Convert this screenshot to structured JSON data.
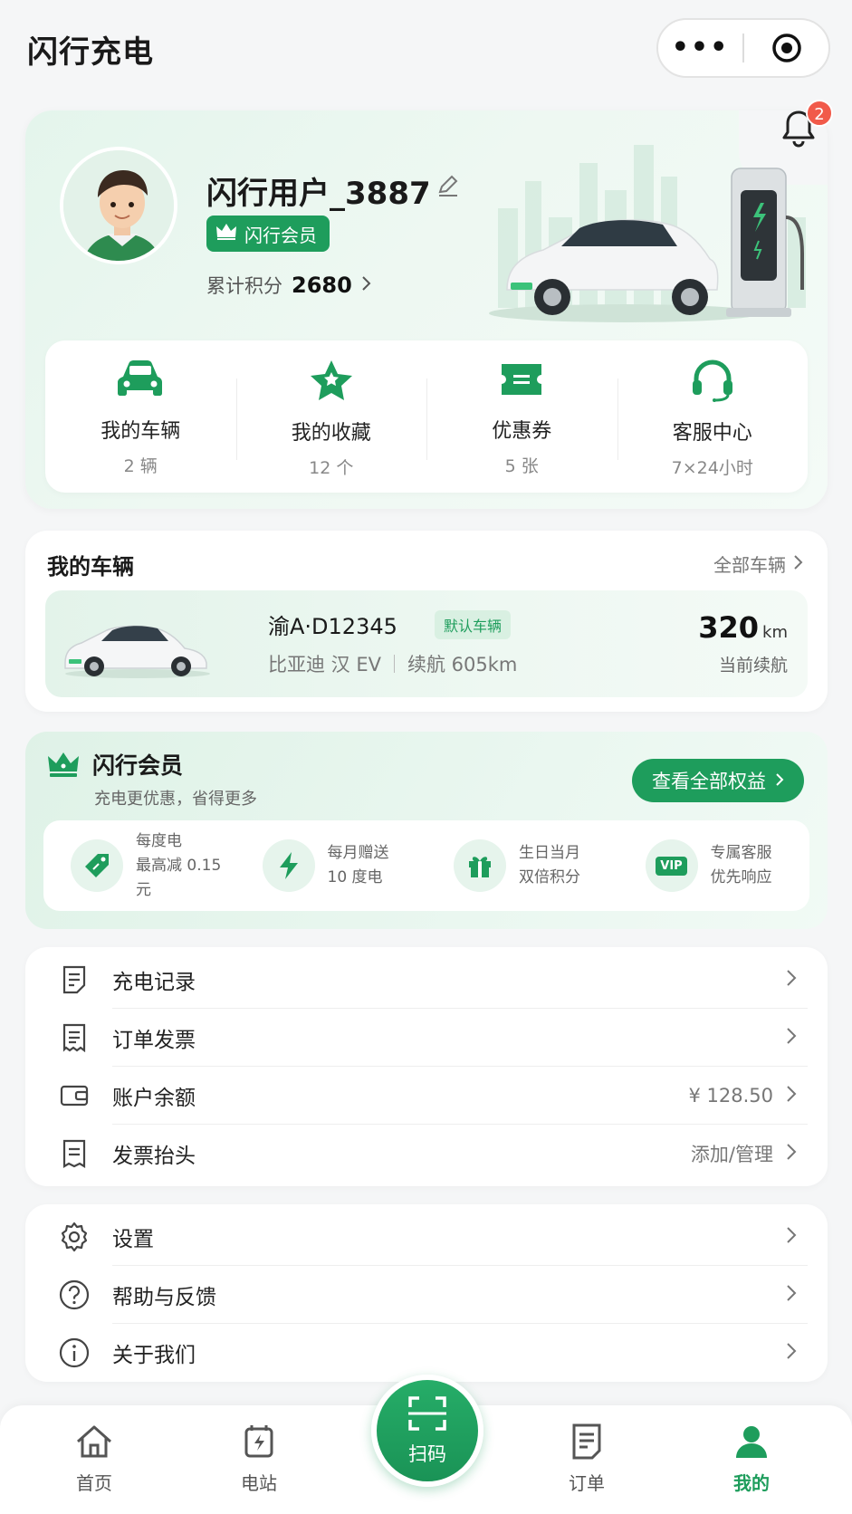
{
  "app": {
    "title": "闪行充电"
  },
  "notifications": {
    "count": "2"
  },
  "profile": {
    "name": "闪行用户_3887",
    "badge": "闪行会员",
    "points_label": "累计积分",
    "points_value": "2680"
  },
  "stats": [
    {
      "label": "我的车辆",
      "sub": "2 辆",
      "icon": "car-icon"
    },
    {
      "label": "我的收藏",
      "sub": "12 个",
      "icon": "star-icon"
    },
    {
      "label": "优惠券",
      "sub": "5 张",
      "icon": "coupon-icon"
    },
    {
      "label": "客服中心",
      "sub": "7×24小时",
      "icon": "headset-icon"
    }
  ],
  "vehicles": {
    "title": "我的车辆",
    "link": "全部车辆",
    "item": {
      "plate": "渝A·D12345",
      "tag": "默认车辆",
      "model": "比亚迪 汉 EV",
      "endurance": "续航 605km",
      "range_value": "320",
      "range_unit": "km",
      "range_caption": "当前续航"
    }
  },
  "membership": {
    "title": "闪行会员",
    "subtitle": "充电更优惠，省得更多",
    "cta": "查看全部权益",
    "perks": [
      {
        "line1": "每度电",
        "line2": "最高减 0.15 元",
        "icon": "discount-tag-icon"
      },
      {
        "line1": "每月赠送",
        "line2": "10 度电",
        "icon": "lightning-icon"
      },
      {
        "line1": "生日当月",
        "line2": "双倍积分",
        "icon": "gift-icon"
      },
      {
        "line1": "专属客服",
        "line2": "优先响应",
        "icon": "vip-icon",
        "vip_text": "VIP"
      }
    ]
  },
  "menu1": [
    {
      "label": "充电记录",
      "value": "",
      "icon": "record-icon"
    },
    {
      "label": "订单发票",
      "value": "",
      "icon": "invoice-icon"
    },
    {
      "label": "账户余额",
      "value": "¥ 128.50",
      "icon": "wallet-icon"
    },
    {
      "label": "发票抬头",
      "value": "添加/管理",
      "icon": "receipt-icon"
    }
  ],
  "menu2": [
    {
      "label": "设置",
      "icon": "gear-icon"
    },
    {
      "label": "帮助与反馈",
      "icon": "help-icon"
    },
    {
      "label": "关于我们",
      "icon": "info-icon"
    }
  ],
  "tabbar": {
    "home": "首页",
    "station": "电站",
    "scan": "扫码",
    "orders": "订单",
    "mine": "我的",
    "active": "我的"
  },
  "colors": {
    "brand": "#1e9d5c",
    "badge": "#f15a4a",
    "background": "#f5f6f7"
  }
}
